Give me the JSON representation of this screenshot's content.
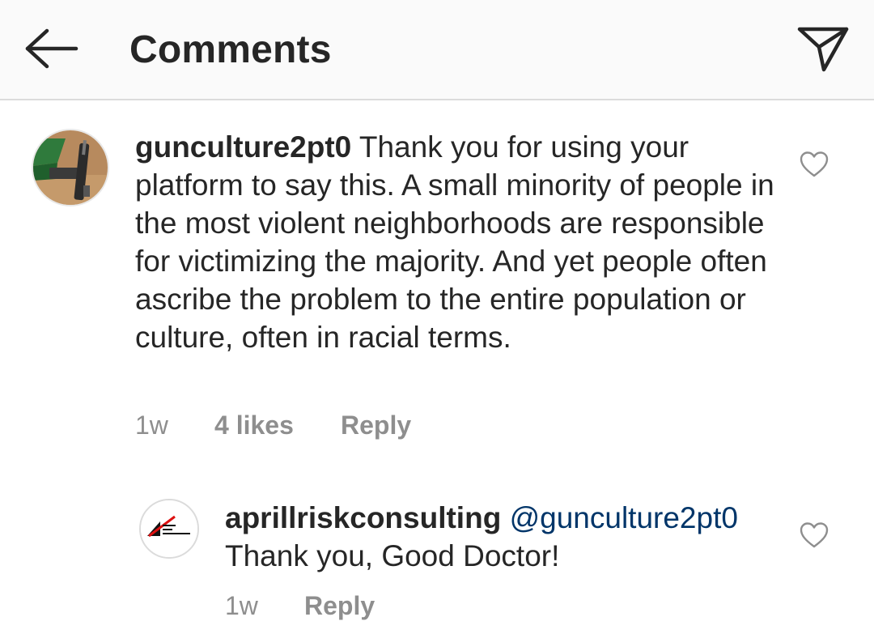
{
  "header": {
    "title": "Comments",
    "back_icon": "arrow-left-icon",
    "share_icon": "paper-plane-icon"
  },
  "comments": [
    {
      "username": "gunculture2pt0",
      "text": "Thank you for using your platform to say this. A small minority of people in the most violent neighborhoods are responsible for victimizing the majority. And yet people often ascribe the problem to the entire population or culture, often in racial terms.",
      "time": "1w",
      "likes": "4 likes",
      "reply_label": "Reply",
      "avatar_icon": "handgun-photo-avatar",
      "like_icon": "heart-outline-icon"
    }
  ],
  "replies": [
    {
      "username": "aprillriskconsulting",
      "mention": "@gunculture2pt0",
      "text": "Thank you, Good Doctor!",
      "time": "1w",
      "reply_label": "Reply",
      "avatar_icon": "april-risk-consulting-logo-avatar",
      "like_icon": "heart-outline-icon"
    }
  ],
  "colors": {
    "header_bg": "#fafafa",
    "text": "#262626",
    "muted": "#8e8e8e",
    "mention": "#003569",
    "divider": "#dbdbdb"
  }
}
